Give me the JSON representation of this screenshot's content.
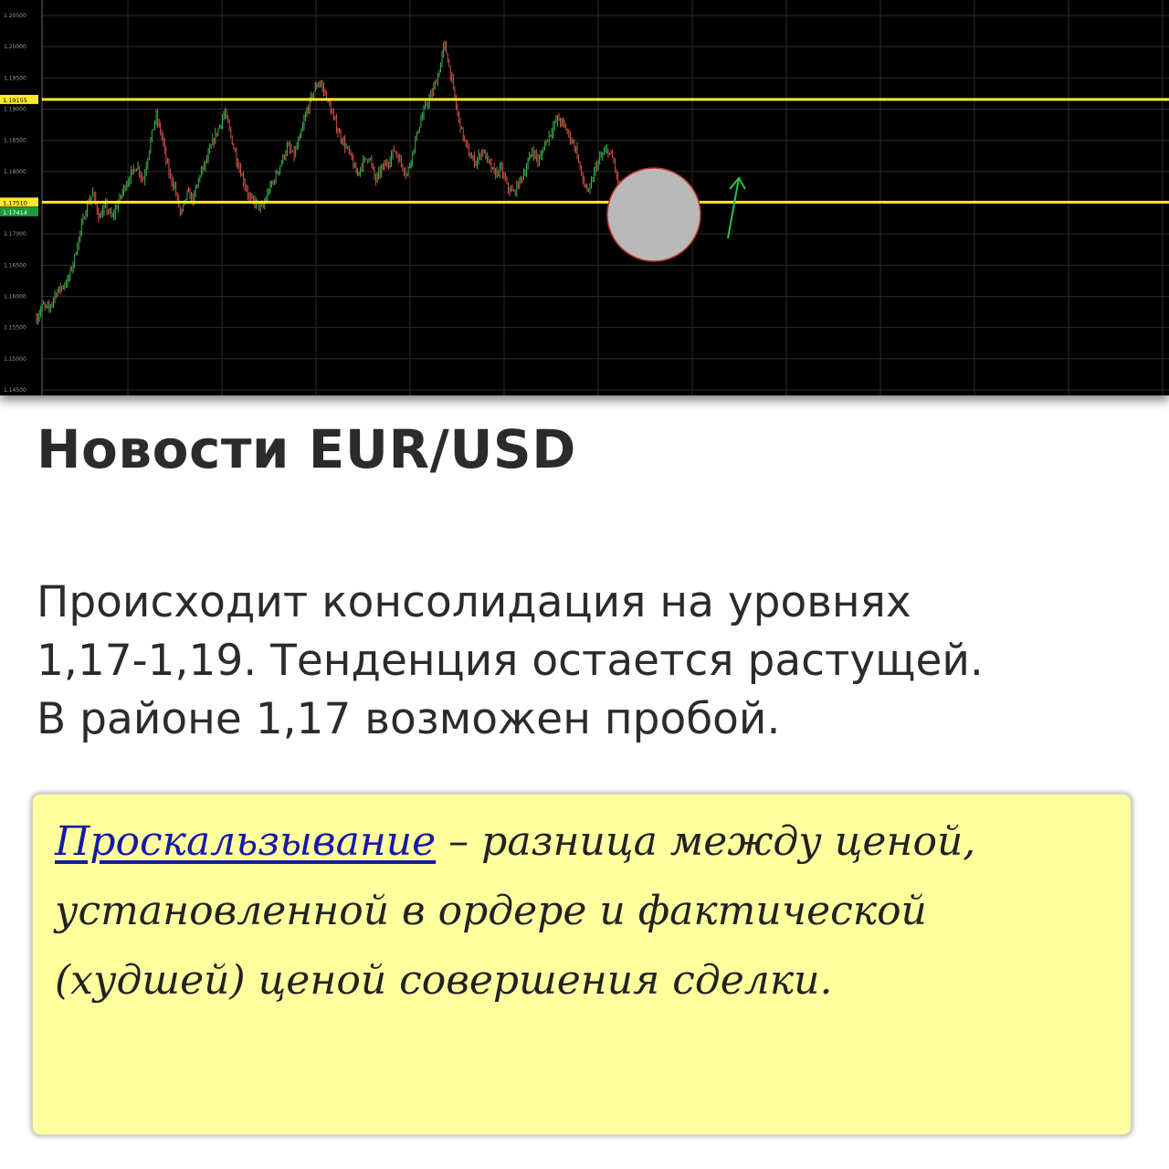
{
  "chart_data": {
    "type": "candlestick",
    "pair": "EUR/USD",
    "y_ticks": [
      "1.20500",
      "1.20000",
      "1.19500",
      "1.19000",
      "1.18500",
      "1.18000",
      "1.17000",
      "1.16500",
      "1.16000",
      "1.15500",
      "1.15000",
      "1.14500"
    ],
    "ylim": [
      1.145,
      1.206
    ],
    "grid": true,
    "levels": [
      {
        "label": "1.19155",
        "price": 1.19155,
        "color": "#ffe82a"
      },
      {
        "label": "1.17510",
        "price": 1.1751,
        "color": "#ffe82a"
      }
    ],
    "current_price": {
      "label": "1.17414",
      "price": 1.17414,
      "color": "#1c9a3a"
    },
    "price_path": [
      1.1565,
      1.1585,
      1.158,
      1.1605,
      1.1615,
      1.1625,
      1.166,
      1.1705,
      1.1745,
      1.1765,
      1.1725,
      1.1745,
      1.1725,
      1.175,
      1.1775,
      1.1795,
      1.181,
      1.1785,
      1.184,
      1.189,
      1.1855,
      1.18,
      1.1775,
      1.173,
      1.1765,
      1.1755,
      1.1795,
      1.1815,
      1.1845,
      1.187,
      1.1895,
      1.1855,
      1.1815,
      1.1785,
      1.1755,
      1.175,
      1.174,
      1.177,
      1.179,
      1.1815,
      1.184,
      1.1825,
      1.1855,
      1.1895,
      1.1925,
      1.1945,
      1.1925,
      1.1895,
      1.1865,
      1.1845,
      1.1825,
      1.1795,
      1.1815,
      1.1825,
      1.1785,
      1.1805,
      1.1815,
      1.1835,
      1.1815,
      1.1795,
      1.1835,
      1.1875,
      1.1905,
      1.1925,
      1.1955,
      1.2005,
      1.1955,
      1.1895,
      1.1855,
      1.1825,
      1.1815,
      1.1835,
      1.1815,
      1.1795,
      1.1805,
      1.1775,
      1.1765,
      1.1785,
      1.1805,
      1.1835,
      1.1815,
      1.1845,
      1.1865,
      1.1885,
      1.1875,
      1.1855,
      1.1835,
      1.1785,
      1.1765,
      1.1805,
      1.1825,
      1.1835,
      1.1815,
      1.176,
      1.1745
    ],
    "marker_circle_price": 1.1731,
    "arrow": {
      "direction": "up",
      "color": "#2ec14a"
    }
  },
  "news": {
    "title": "Новости EUR/USD",
    "lines": [
      "Происходит консолидация на уровнях",
      "1,17-1,19. Тенденция остается растущей.",
      "В районе 1,17 возможен пробой."
    ]
  },
  "note": {
    "term": "Проскальзывание",
    "definition": " – разница между ценой, установленной в ордере и фактической (худшей) ценой совершения сделки."
  }
}
